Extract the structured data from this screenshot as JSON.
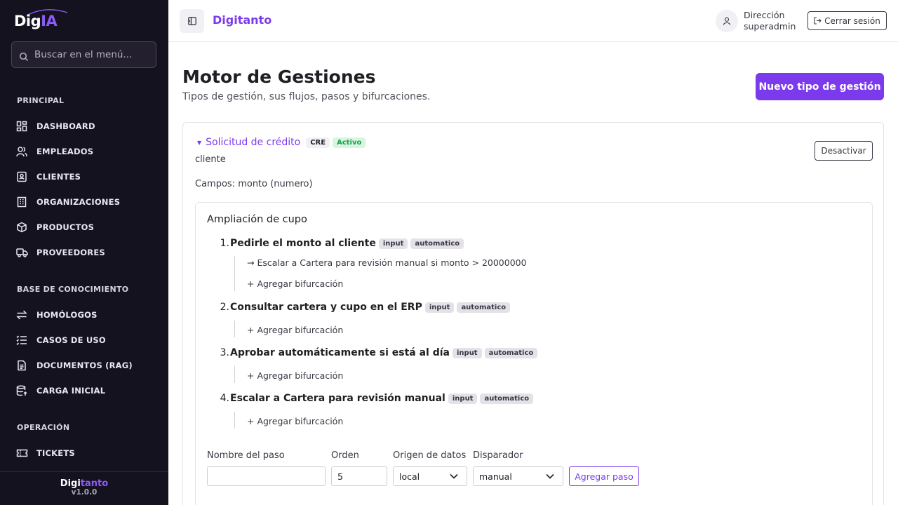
{
  "sidebar": {
    "logo": {
      "dig": "Dig",
      "ia": "IA"
    },
    "search_placeholder": "Buscar en el menú...",
    "sections": [
      {
        "title": "PRINCIPAL",
        "items": [
          {
            "label": "DASHBOARD",
            "icon": "dashboard-icon"
          },
          {
            "label": "EMPLEADOS",
            "icon": "users-icon"
          },
          {
            "label": "CLIENTES",
            "icon": "contact-card-icon"
          },
          {
            "label": "ORGANIZACIONES",
            "icon": "building-icon"
          },
          {
            "label": "PRODUCTOS",
            "icon": "package-icon"
          },
          {
            "label": "PROVEEDORES",
            "icon": "truck-icon"
          }
        ]
      },
      {
        "title": "BASE DE CONOCIMIENTO",
        "items": [
          {
            "label": "HOMÓLOGOS",
            "icon": "swap-arrows-icon"
          },
          {
            "label": "CASOS DE USO",
            "icon": "list-check-icon"
          },
          {
            "label": "DOCUMENTOS (RAG)",
            "icon": "document-icon"
          },
          {
            "label": "CARGA INICIAL",
            "icon": "database-upload-icon"
          }
        ]
      },
      {
        "title": "OPERACIÓN",
        "items": [
          {
            "label": "TICKETS",
            "icon": "ticket-icon"
          }
        ]
      }
    ],
    "footer": {
      "brand_a": "Digi",
      "brand_b": "tanto",
      "version": "v1.0.0"
    }
  },
  "header": {
    "brand": "Digitanto",
    "user_role": "Dirección",
    "user_name": "superadmin",
    "logout_label": "Cerrar sesión"
  },
  "page": {
    "title": "Motor de Gestiones",
    "subtitle": "Tipos de gestión, sus flujos, pasos y bifurcaciones.",
    "new_button": "Nuevo tipo de gestión"
  },
  "gestion": {
    "name": "Solicitud de crédito",
    "code": "CRE",
    "status": "Activo",
    "audience": "cliente",
    "fields": "Campos: monto (numero)",
    "deactivate_label": "Desactivar",
    "flow": {
      "name": "Ampliación de cupo",
      "add_branch_label": "+ Agregar bifurcación",
      "steps": [
        {
          "num": "1.",
          "name": "Pedirle el monto al cliente",
          "tags": [
            "input",
            "automatico"
          ],
          "rules": [
            "→ Escalar a Cartera para revisión manual si monto > 20000000"
          ]
        },
        {
          "num": "2.",
          "name": "Consultar cartera y cupo en el ERP",
          "tags": [
            "input",
            "automatico"
          ],
          "rules": []
        },
        {
          "num": "3.",
          "name": "Aprobar automáticamente si está al día",
          "tags": [
            "input",
            "automatico"
          ],
          "rules": []
        },
        {
          "num": "4.",
          "name": "Escalar a Cartera para revisión manual",
          "tags": [
            "input",
            "automatico"
          ],
          "rules": []
        }
      ],
      "form": {
        "name_label": "Nombre del paso",
        "name_value": "",
        "order_label": "Orden",
        "order_value": "5",
        "source_label": "Origen de datos",
        "source_value": "local",
        "trigger_label": "Disparador",
        "trigger_value": "manual",
        "add_step_label": "Agregar paso"
      }
    }
  },
  "colors": {
    "accent": "#7c3aed",
    "sidebar_bg": "#15121f",
    "success": "#16a34a"
  }
}
